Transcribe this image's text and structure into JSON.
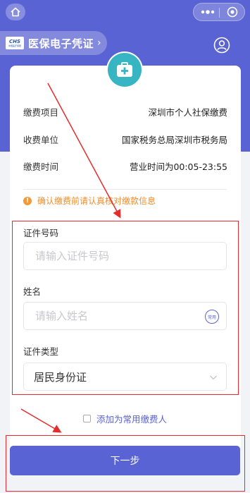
{
  "header": {
    "title": "医保电子凭证",
    "arrow": "›",
    "logo_text": "CHS",
    "logo_sub": "中国医疗保障"
  },
  "info": {
    "rows": [
      {
        "label": "缴费项目",
        "value": "深圳市个人社保缴费"
      },
      {
        "label": "收费单位",
        "value": "国家税务总局深圳市税务局"
      },
      {
        "label": "缴费时间",
        "value": "营业时间为00:05-23:55"
      }
    ],
    "notice": "确认缴费前请认真核对缴款信息",
    "notice_icon": "!"
  },
  "form": {
    "id_number": {
      "label": "证件号码",
      "placeholder": "请输入证件号码",
      "value": ""
    },
    "name": {
      "label": "姓名",
      "placeholder": "请输入姓名",
      "value": "",
      "common_label": "常用"
    },
    "id_type": {
      "label": "证件类型",
      "value": "居民身份证"
    }
  },
  "add_common_payer": "添加为常用缴费人",
  "next_button": "下一步",
  "colors": {
    "primary": "#5a63d3",
    "teal": "#37b5c3",
    "warning": "#ef8c2b",
    "highlight": "#e52b2b"
  }
}
